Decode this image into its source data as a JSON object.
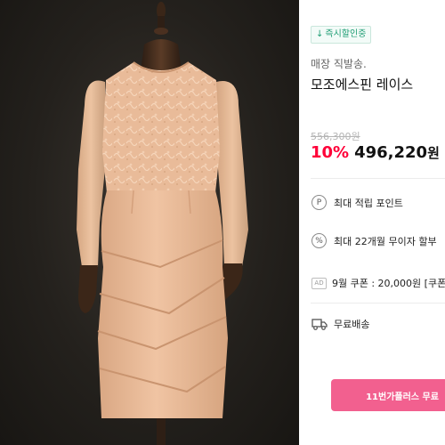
{
  "product_image": {
    "alt": "dress-on-mannequin"
  },
  "badge": {
    "icon": "down-arrow-icon",
    "label": "즉시할인중",
    "color": "#1f9e74"
  },
  "product": {
    "subtitle": "매장 직발송.",
    "title": "모조에스핀 레이스",
    "original_price": "556,300원",
    "discount": "10%",
    "price": "496,220",
    "currency": "원"
  },
  "benefits": {
    "points": {
      "icon": "p-circle-icon",
      "icon_glyph": "P",
      "label": "최대 적립 포인트"
    },
    "installment": {
      "icon": "percent-circle-icon",
      "icon_glyph": "%",
      "label": "최대 22개월 무이자 할부"
    },
    "coupon": {
      "tag": "AD",
      "label": "9월 쿠폰 : 20,000원 [쿠폰"
    }
  },
  "shipping": {
    "icon": "truck-icon",
    "label": "무료배송"
  },
  "cta": {
    "label": "11번가플러스 무료"
  },
  "colors": {
    "accent": "#ff0038",
    "cta": "#f2608f",
    "dress": "#e7b896"
  }
}
